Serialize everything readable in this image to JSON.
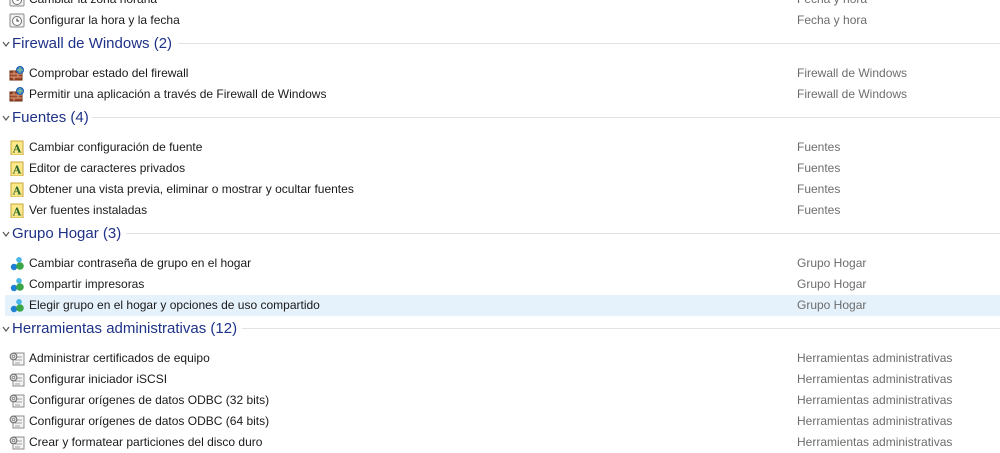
{
  "top_rows": [
    {
      "label": "Cambiar la zona horaria",
      "category": "Fecha y hora",
      "icon": "clock-icon"
    },
    {
      "label": "Configurar la hora y la fecha",
      "category": "Fecha y hora",
      "icon": "clock-icon"
    }
  ],
  "groups": {
    "firewall": {
      "title": "Firewall de Windows (2)",
      "items": [
        {
          "label": "Comprobar estado del firewall",
          "category": "Firewall de Windows",
          "icon": "firewall-icon"
        },
        {
          "label": "Permitir una aplicación a través de Firewall de Windows",
          "category": "Firewall de Windows",
          "icon": "firewall-icon"
        }
      ]
    },
    "fonts": {
      "title": "Fuentes (4)",
      "items": [
        {
          "label": "Cambiar configuración de fuente",
          "category": "Fuentes",
          "icon": "font-icon"
        },
        {
          "label": "Editor de caracteres privados",
          "category": "Fuentes",
          "icon": "font-icon"
        },
        {
          "label": "Obtener una vista previa, eliminar o mostrar y ocultar fuentes",
          "category": "Fuentes",
          "icon": "font-icon"
        },
        {
          "label": "Ver fuentes instaladas",
          "category": "Fuentes",
          "icon": "font-icon"
        }
      ]
    },
    "homegroup": {
      "title": "Grupo Hogar (3)",
      "items": [
        {
          "label": "Cambiar contraseña de grupo en el hogar",
          "category": "Grupo Hogar",
          "icon": "homegroup-icon"
        },
        {
          "label": "Compartir impresoras",
          "category": "Grupo Hogar",
          "icon": "homegroup-icon"
        },
        {
          "label": "Elegir grupo en el hogar y opciones de uso compartido",
          "category": "Grupo Hogar",
          "icon": "homegroup-icon",
          "highlighted": true
        }
      ]
    },
    "admin": {
      "title": "Herramientas administrativas (12)",
      "items": [
        {
          "label": "Administrar certificados de equipo",
          "category": "Herramientas administrativas",
          "icon": "admin-tools-icon"
        },
        {
          "label": "Configurar iniciador iSCSI",
          "category": "Herramientas administrativas",
          "icon": "admin-tools-icon"
        },
        {
          "label": "Configurar orígenes de datos ODBC (32 bits)",
          "category": "Herramientas administrativas",
          "icon": "admin-tools-icon"
        },
        {
          "label": "Configurar orígenes de datos ODBC (64 bits)",
          "category": "Herramientas administrativas",
          "icon": "admin-tools-icon"
        },
        {
          "label": "Crear y formatear particiones del disco duro",
          "category": "Herramientas administrativas",
          "icon": "admin-tools-icon"
        }
      ]
    }
  },
  "colors": {
    "group_title": "#1e3287",
    "category_text": "#6d6d6d",
    "highlight": "#e5f1fb"
  }
}
